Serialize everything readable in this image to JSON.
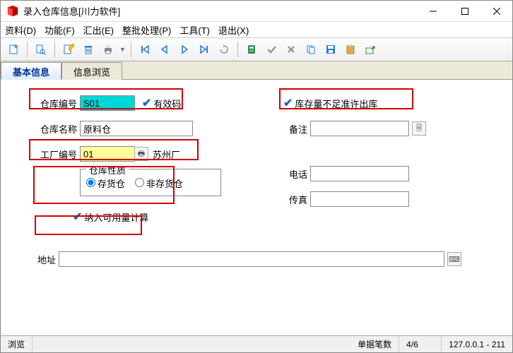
{
  "window": {
    "title": "录入仓库信息[川力软件]"
  },
  "menu": {
    "d": "资料(D)",
    "f": "功能(F)",
    "e": "汇出(E)",
    "p": "整批处理(P)",
    "t": "工具(T)",
    "x": "退出(X)"
  },
  "tabs": {
    "basic": "基本信息",
    "browse": "信息浏览"
  },
  "form": {
    "code_label": "仓库编号",
    "code_value": "S01",
    "valid_code": "有效码",
    "name_label": "仓库名称",
    "name_value": "原料仓",
    "factory_label": "工厂编号",
    "factory_value": "01",
    "factory_name": "苏州厂",
    "nature_legend": "仓库性质",
    "radio_stock": "存货仓",
    "radio_nonstock": "非存货仓",
    "include_calc": "纳入可用量计算",
    "shortage_allow": "库存量不足准许出库",
    "remark_label": "备注",
    "remark_value": "",
    "phone_label": "电话",
    "phone_value": "",
    "fax_label": "传真",
    "fax_value": "",
    "addr_label": "地址",
    "addr_value": ""
  },
  "status": {
    "browse": "浏览",
    "count_label": "单据笔数",
    "count_value": "4/6",
    "host": "127.0.0.1 - 211"
  }
}
